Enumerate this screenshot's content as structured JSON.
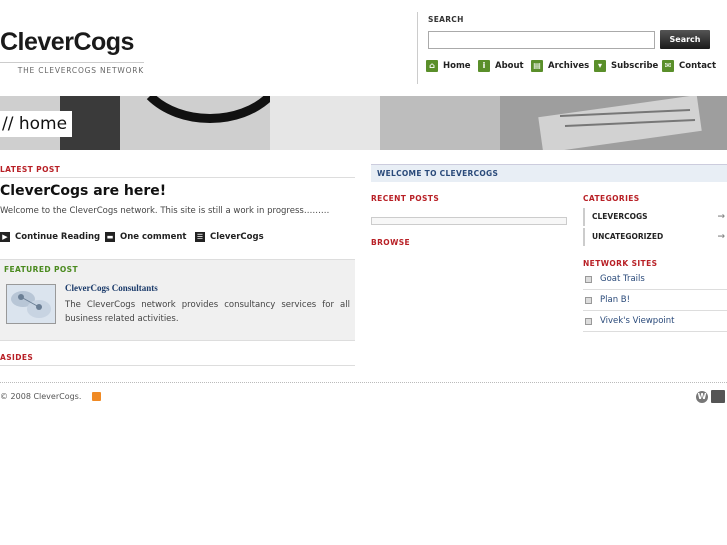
{
  "header": {
    "site_title": "CleverCogs",
    "tagline": "THE CLEVERCOGS NETWORK"
  },
  "search": {
    "label": "SEARCH",
    "input_value": "",
    "button_label": "Search"
  },
  "nav": {
    "items": [
      {
        "label": "Home",
        "icon": "home-icon"
      },
      {
        "label": "About",
        "icon": "info-icon"
      },
      {
        "label": "Archives",
        "icon": "archive-icon"
      },
      {
        "label": "Subscribe",
        "icon": "subscribe-icon"
      },
      {
        "label": "Contact",
        "icon": "mail-icon"
      }
    ]
  },
  "banner": {
    "page_label": "// home"
  },
  "latest_post": {
    "section_heading": "LATEST POST",
    "title": "CleverCogs are here!",
    "excerpt": "Welcome to the CleverCogs network. This site is still a work in progress………",
    "meta": {
      "continue_label": "Continue Reading",
      "comments_label": "One comment",
      "category_label": "CleverCogs"
    }
  },
  "featured_post": {
    "section_heading": "FEATURED POST",
    "title": "CleverCogs Consultants",
    "text": "The CleverCogs network provides consultancy services for all business related activities."
  },
  "asides": {
    "section_heading": "ASIDES"
  },
  "sidebar": {
    "welcome_title": "WELCOME TO CLEVERCOGS",
    "recent_posts_heading": "RECENT POSTS",
    "browse_heading": "BROWSE",
    "categories_heading": "CATEGORIES",
    "categories": [
      "CLEVERCOGS",
      "UNCATEGORIZED"
    ],
    "network_heading": "NETWORK SITES",
    "network_sites": [
      "Goat Trails",
      "Plan B!",
      "Vivek's Viewpoint"
    ]
  },
  "footer": {
    "copyright": "© 2008 CleverCogs."
  },
  "colors": {
    "accent_red": "#b81f25",
    "nav_icon_green": "#5a8f2a",
    "featured_green": "#4a8a1e",
    "link_blue": "#2a4a7a"
  }
}
